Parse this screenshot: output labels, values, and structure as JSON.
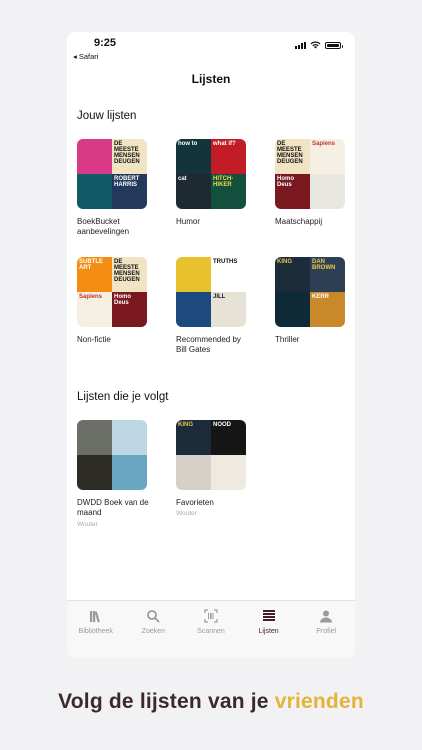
{
  "status": {
    "time": "9:25",
    "back_label": "◂ Safari"
  },
  "nav": {
    "title": "Lijsten"
  },
  "sections": [
    {
      "title": "Jouw lijsten",
      "lists": [
        {
          "label": "BoekBucket aanbevelingen",
          "owner": "",
          "covers": [
            {
              "text": "",
              "bg": "#d93a87",
              "fg": "#ffffff"
            },
            {
              "text": "DE MEESTE MENSEN DEUGEN",
              "bg": "#f1e4c3",
              "fg": "#111111"
            },
            {
              "text": "",
              "bg": "#0f5a66",
              "fg": "#ffffff"
            },
            {
              "text": "ROBERT HARRIS",
              "bg": "#23395b",
              "fg": "#ffffff"
            }
          ]
        },
        {
          "label": "Humor",
          "owner": "",
          "covers": [
            {
              "text": "how to",
              "bg": "#12343a",
              "fg": "#ffffff"
            },
            {
              "text": "what if?",
              "bg": "#c21c27",
              "fg": "#ffffff"
            },
            {
              "text": "cat",
              "bg": "#1d2a30",
              "fg": "#ffffff"
            },
            {
              "text": "HITCH-HIKER",
              "bg": "#124f3c",
              "fg": "#f0d84a"
            }
          ]
        },
        {
          "label": "Maatschappij",
          "owner": "",
          "covers": [
            {
              "text": "DE MEESTE MENSEN DEUGEN",
              "bg": "#f1e4c3",
              "fg": "#111111"
            },
            {
              "text": "Sapiens",
              "bg": "#f5efe4",
              "fg": "#c0392b"
            },
            {
              "text": "Homo Deus",
              "bg": "#7a1820",
              "fg": "#ffffff"
            },
            {
              "text": "",
              "bg": "#e9e7e1",
              "fg": "#333333"
            }
          ]
        }
      ]
    },
    {
      "title": "",
      "lists": [
        {
          "label": "Non-fictie",
          "owner": "",
          "covers": [
            {
              "text": "SUBTLE ART",
              "bg": "#f28c12",
              "fg": "#ffffff"
            },
            {
              "text": "DE MEESTE MENSEN DEUGEN",
              "bg": "#f1e4c3",
              "fg": "#111111"
            },
            {
              "text": "Sapiens",
              "bg": "#f5efe4",
              "fg": "#c0392b"
            },
            {
              "text": "Homo Deus",
              "bg": "#7a1820",
              "fg": "#ffffff"
            }
          ]
        },
        {
          "label": "Recommended by Bill Gates",
          "owner": "",
          "covers": [
            {
              "text": "",
              "bg": "#e8c12e",
              "fg": "#111111"
            },
            {
              "text": "TRUTHS",
              "bg": "#ffffff",
              "fg": "#111111"
            },
            {
              "text": "",
              "bg": "#1c4a7e",
              "fg": "#ffffff"
            },
            {
              "text": "JILL",
              "bg": "#e6e2d6",
              "fg": "#1a1a1a"
            }
          ]
        },
        {
          "label": "Thriller",
          "owner": "",
          "covers": [
            {
              "text": "KING",
              "bg": "#1c2b3a",
              "fg": "#e7c34c"
            },
            {
              "text": "DAN BROWN",
              "bg": "#2c3f55",
              "fg": "#f2c84b"
            },
            {
              "text": "",
              "bg": "#0e2a39",
              "fg": "#ffffff"
            },
            {
              "text": "KERR",
              "bg": "#c9892a",
              "fg": "#ffffff"
            }
          ]
        }
      ]
    },
    {
      "title": "Lijsten die je volgt",
      "lists": [
        {
          "label": "DWDD Boek van de maand",
          "owner": "Wouter",
          "covers": [
            {
              "text": "",
              "bg": "#6b6f68",
              "fg": "#ffffff"
            },
            {
              "text": "",
              "bg": "#bcd7e3",
              "fg": "#ffffff"
            },
            {
              "text": "",
              "bg": "#2e2c27",
              "fg": "#ffffff"
            },
            {
              "text": "",
              "bg": "#6aa6c4",
              "fg": "#ffffff"
            }
          ]
        },
        {
          "label": "Favorieten",
          "owner": "Wouter",
          "covers": [
            {
              "text": "KING",
              "bg": "#1c2b3a",
              "fg": "#e7c34c"
            },
            {
              "text": "NOOD",
              "bg": "#151515",
              "fg": "#ffffff"
            },
            {
              "text": "",
              "bg": "#d6d0c7",
              "fg": "#222222"
            },
            {
              "text": "",
              "bg": "#efe9df",
              "fg": "#7a1820"
            }
          ]
        }
      ]
    }
  ],
  "tabs": [
    {
      "label": "Bibliotheek",
      "icon": "books-icon",
      "active": false
    },
    {
      "label": "Zoeken",
      "icon": "search-icon",
      "active": false
    },
    {
      "label": "Scannen",
      "icon": "barcode-icon",
      "active": false
    },
    {
      "label": "Lijsten",
      "icon": "list-icon",
      "active": true
    },
    {
      "label": "Profiel",
      "icon": "person-icon",
      "active": false
    }
  ],
  "tagline": {
    "prefix": "Volg de lijsten van je",
    "highlight": "vrienden"
  },
  "colors": {
    "accent": "#4a1c2b",
    "highlight": "#e4b33a",
    "inactive": "#9a9a9a"
  }
}
